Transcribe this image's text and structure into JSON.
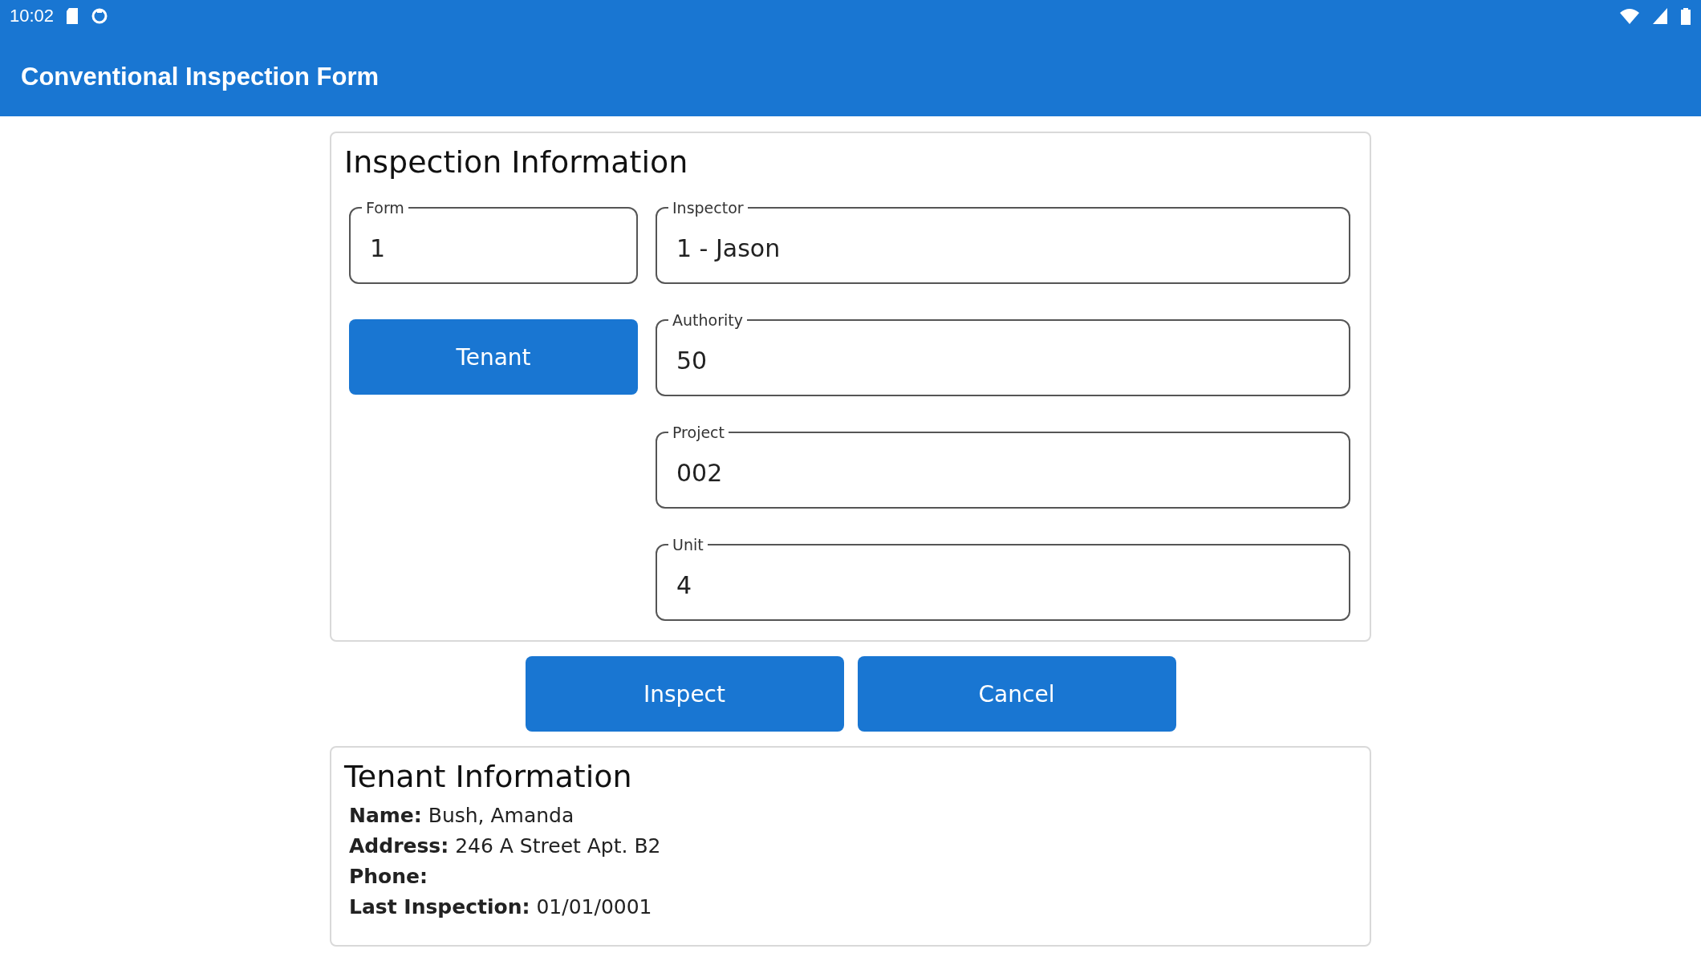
{
  "status_bar": {
    "time": "10:02"
  },
  "app_bar": {
    "title": "Conventional Inspection Form"
  },
  "inspection": {
    "heading": "Inspection Information",
    "fields": [
      {
        "label": "Form",
        "value": "1"
      },
      {
        "label": "Inspector",
        "value": "1 - Jason"
      },
      {
        "label": "Authority",
        "value": "50"
      },
      {
        "label": "Project",
        "value": "002"
      },
      {
        "label": "Unit",
        "value": "4"
      }
    ],
    "tenant_button": "Tenant"
  },
  "buttons": [
    "Inspect",
    "Cancel"
  ],
  "tenant": {
    "heading": "Tenant Information",
    "lines": [
      "**Name:** Bush, Amanda",
      "**Address:** 246 A Street Apt. B2",
      "**Phone:**",
      "**Last Inspection:** 01/01/0001"
    ]
  }
}
